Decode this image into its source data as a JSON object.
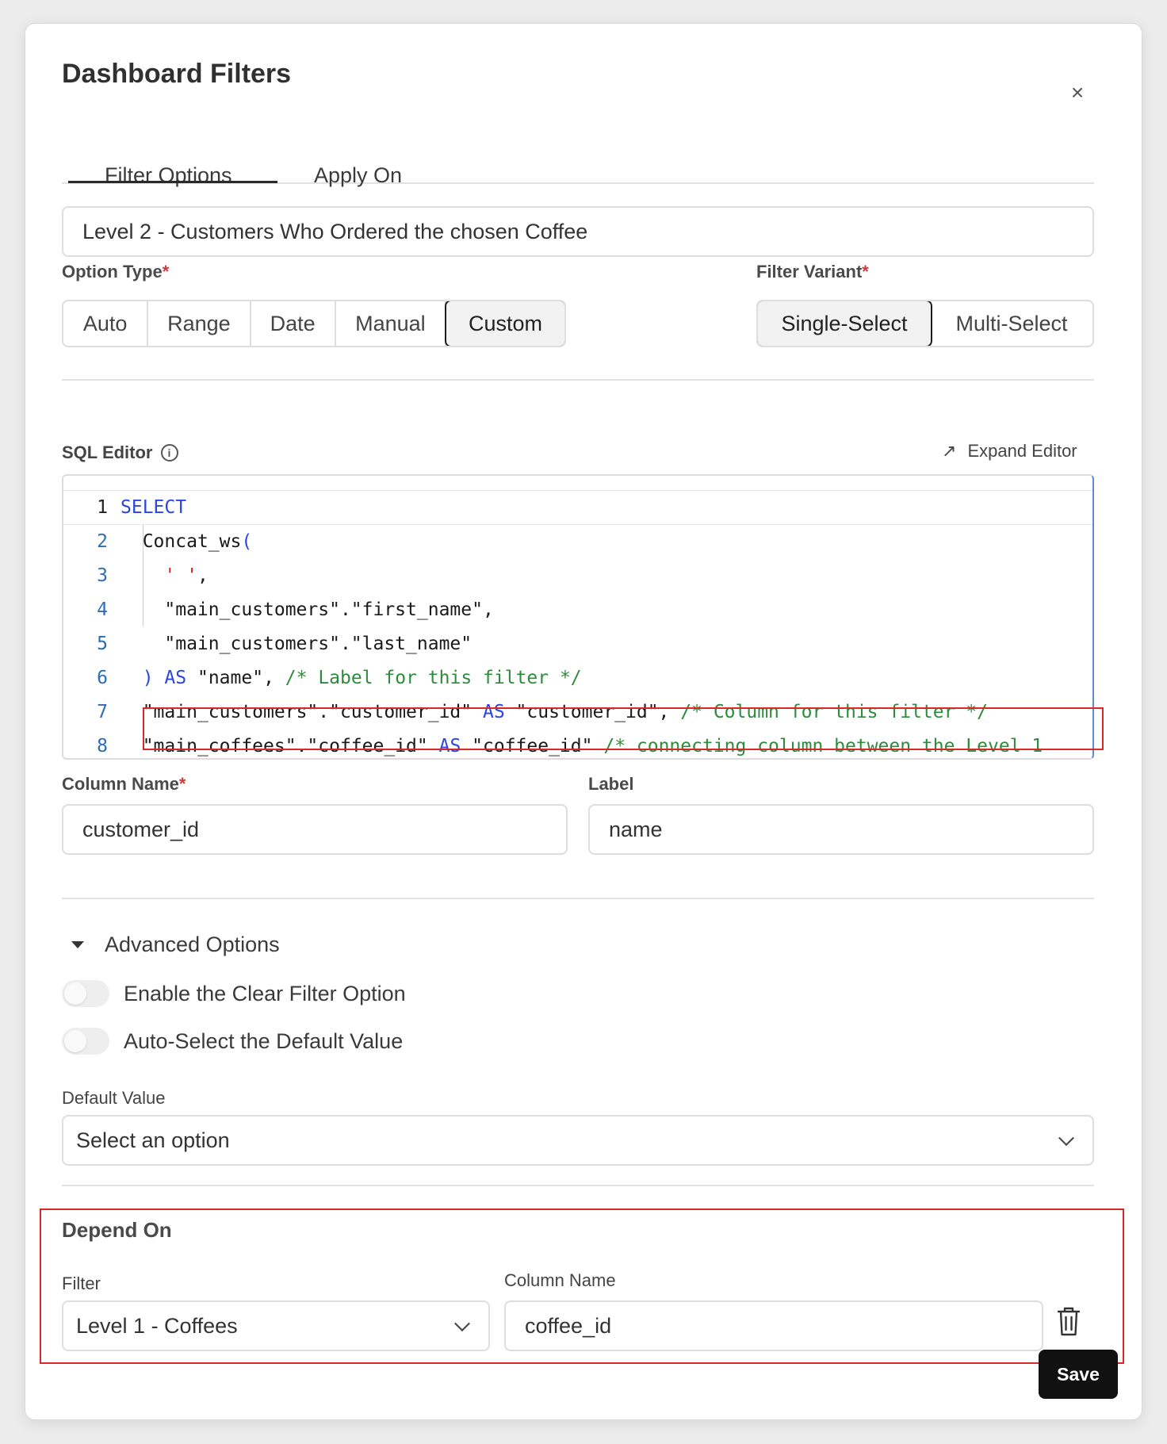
{
  "dialog": {
    "title": "Dashboard Filters",
    "close_icon": "×"
  },
  "tabs": [
    {
      "label": "Filter Options",
      "active": true
    },
    {
      "label": "Apply On",
      "active": false
    }
  ],
  "filter_title": "Level 2 - Customers Who Ordered the chosen Coffee",
  "option_type": {
    "label": "Option Type",
    "required_mark": "*",
    "options": [
      "Auto",
      "Range",
      "Date",
      "Manual",
      "Custom"
    ],
    "selected": "Custom"
  },
  "filter_variant": {
    "label": "Filter Variant",
    "required_mark": "*",
    "options": [
      "Single-Select",
      "Multi-Select"
    ],
    "selected": "Single-Select"
  },
  "sql_editor": {
    "label": "SQL Editor",
    "info_icon": "i",
    "expand_label": "Expand Editor",
    "expand_icon": "↗",
    "lines": [
      {
        "n": "1"
      },
      {
        "n": "2"
      },
      {
        "n": "3"
      },
      {
        "n": "4"
      },
      {
        "n": "5"
      },
      {
        "n": "6"
      },
      {
        "n": "7"
      },
      {
        "n": "8"
      }
    ],
    "code": {
      "l1_kw": "SELECT",
      "l2_fn": "Concat_ws",
      "l2_paren": "(",
      "l3_str": "' '",
      "l3_comma": ",",
      "l4": "\"main_customers\".\"first_name\",",
      "l5": "\"main_customers\".\"last_name\"",
      "l6_paren": ")",
      "l6_kw": "AS",
      "l6_alias": "\"name\",",
      "l6_cm": "/* Label for this filter */",
      "l7_col": "\"main_customers\".\"customer_id\"",
      "l7_kw": "AS",
      "l7_alias": "\"customer_id\",",
      "l7_cm": "/* Column for this filter */",
      "l8_col": "\"main_coffees\".\"coffee_id\"",
      "l8_kw": "AS",
      "l8_alias": "\"coffee_id\"",
      "l8_cm": "/* connecting column between the Level 1"
    }
  },
  "column_name": {
    "label": "Column Name",
    "required_mark": "*",
    "value": "customer_id"
  },
  "label_field": {
    "label": "Label",
    "value": "name"
  },
  "advanced": {
    "label": "Advanced Options",
    "toggles": [
      {
        "label": "Enable the Clear Filter Option",
        "on": false
      },
      {
        "label": "Auto-Select the Default Value",
        "on": false
      }
    ],
    "default_value": {
      "label": "Default Value",
      "placeholder": "Select an option"
    }
  },
  "depend_on": {
    "title": "Depend On",
    "filter_label": "Filter",
    "filter_value": "Level 1 - Coffees",
    "column_label": "Column Name",
    "column_value": "coffee_id",
    "delete_icon": "trash-icon"
  },
  "save_label": "Save",
  "colors": {
    "accent": "#111111",
    "keyword": "#2a45e0",
    "comment": "#2e8b3d",
    "string": "#d4281f",
    "highlight_box": "#d82828"
  }
}
